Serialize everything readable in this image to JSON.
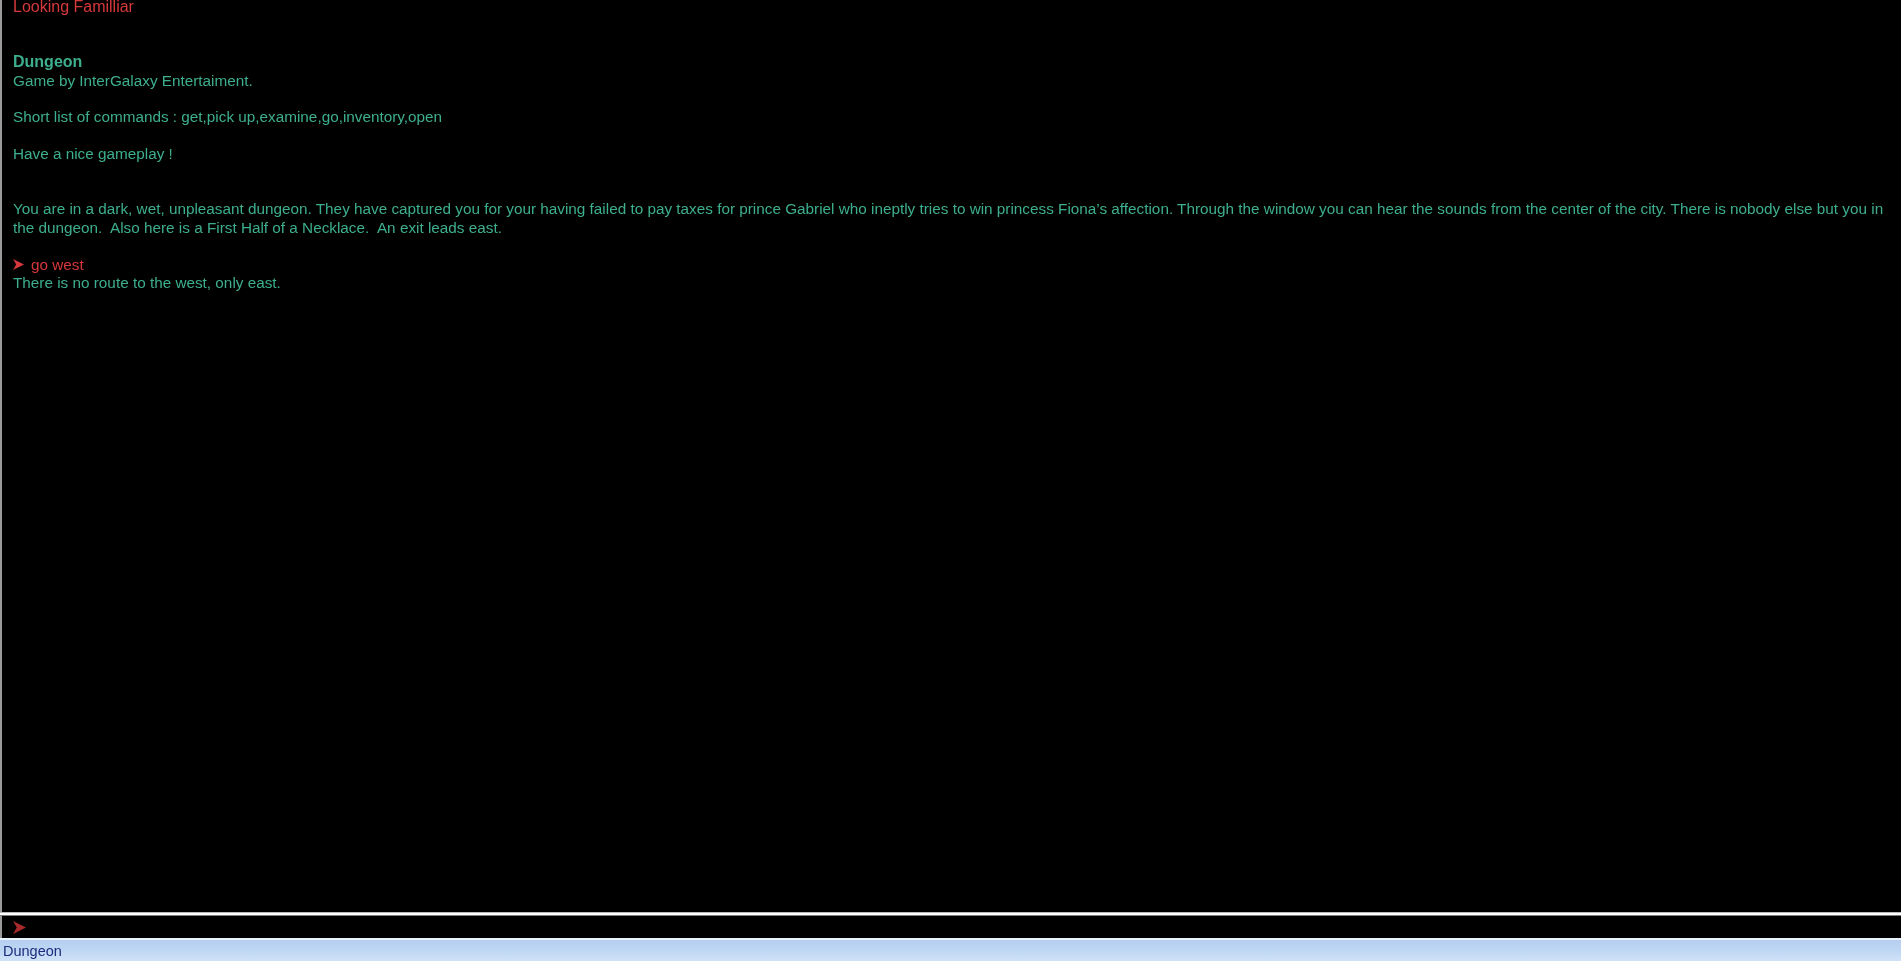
{
  "output": {
    "sections": [
      {
        "paragraphs": [
          [
            {
              "kind": "notice",
              "text": "Looking Familliar"
            }
          ]
        ]
      },
      {
        "paragraphs": [
          [
            {
              "kind": "heading",
              "text": "Dungeon"
            },
            {
              "kind": "text",
              "text": "Game by InterGalaxy Entertaiment."
            }
          ],
          [
            {
              "kind": "text",
              "text": "Short list of commands : get,pick up,examine,go,inventory,open"
            }
          ],
          [
            {
              "kind": "text",
              "text": "Have a nice gameplay !"
            }
          ]
        ]
      },
      {
        "paragraphs": [
          [
            {
              "kind": "text",
              "text": "You are in a dark, wet, unpleasant dungeon. They have captured you for your having failed to pay taxes for prince Gabriel who ineptly tries to win princess Fiona’s affection. Through the window you can hear the sounds from the center of the city. There is nobody else but you in the dungeon.  Also here is a First Half of a Necklace.  An exit leads east."
            }
          ],
          [
            {
              "kind": "command",
              "text": "go west"
            },
            {
              "kind": "text",
              "text": "There is no route to the west, only east."
            }
          ]
        ]
      }
    ]
  },
  "status_bar": {
    "text": "Dungeon"
  }
}
